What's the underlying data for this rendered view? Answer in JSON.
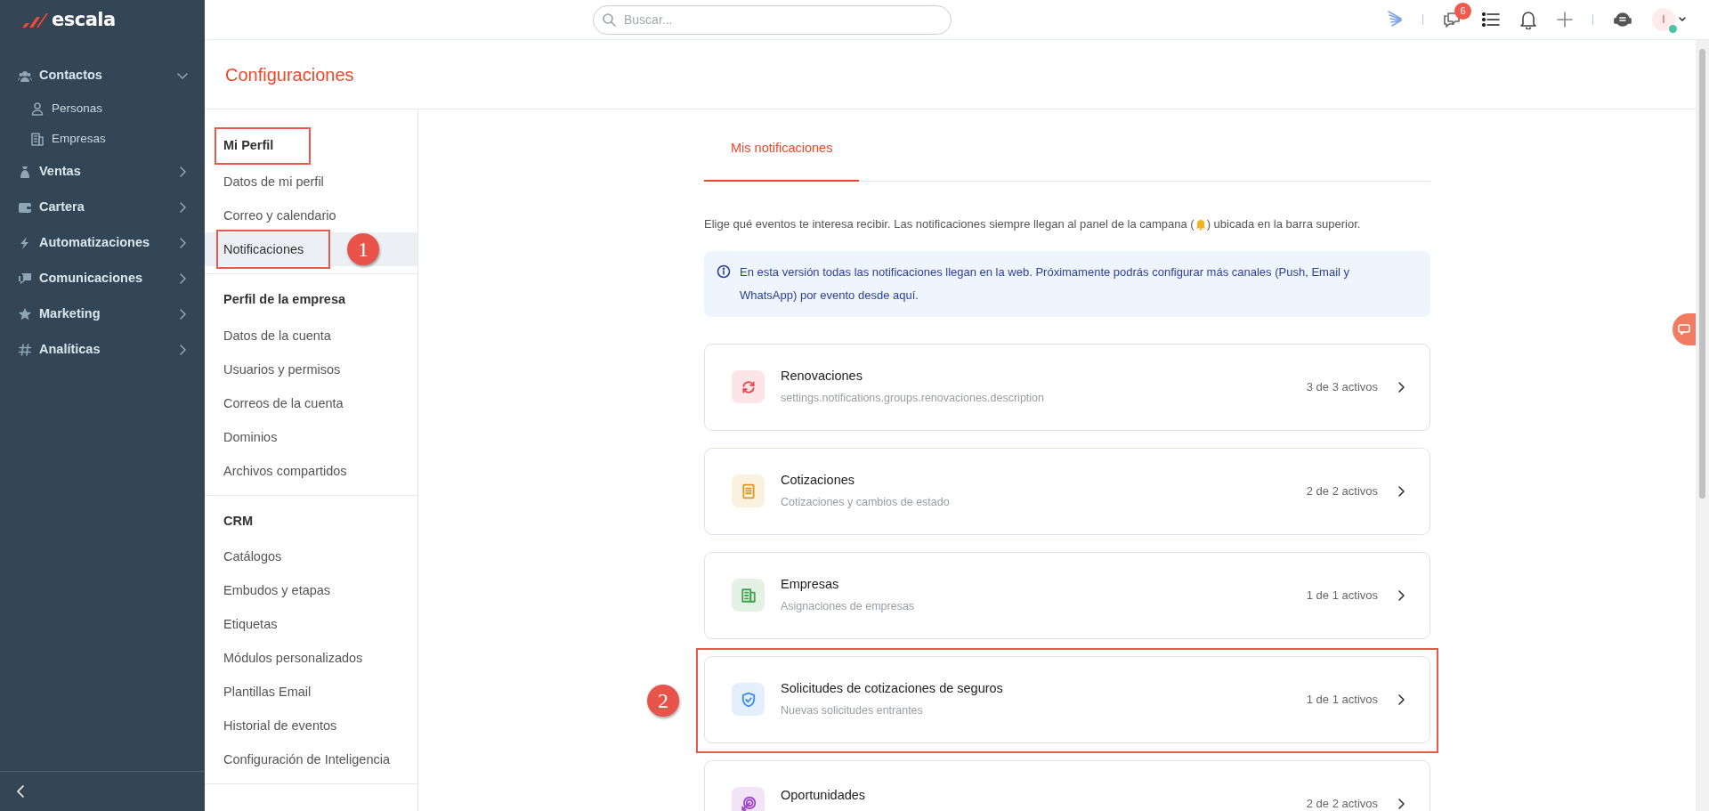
{
  "app": {
    "logo_text": "escala"
  },
  "sidebar": {
    "items": [
      {
        "label": "Contactos",
        "expanded": true,
        "children": [
          {
            "label": "Personas"
          },
          {
            "label": "Empresas"
          }
        ]
      },
      {
        "label": "Ventas",
        "expanded": false
      },
      {
        "label": "Cartera",
        "expanded": false
      },
      {
        "label": "Automatizaciones",
        "expanded": false
      },
      {
        "label": "Comunicaciones",
        "expanded": false
      },
      {
        "label": "Marketing",
        "expanded": false
      },
      {
        "label": "Analíticas",
        "expanded": false
      }
    ]
  },
  "topbar": {
    "search": {
      "placeholder": "Buscar..."
    },
    "messages_badge": "6",
    "avatar_initial": "I"
  },
  "page": {
    "title": "Configuraciones"
  },
  "settings_menu": {
    "groups": [
      {
        "title": "Mi Perfil",
        "highlighted": true,
        "items": [
          {
            "label": "Datos de mi perfil",
            "selected": false,
            "highlighted": false
          },
          {
            "label": "Correo y calendario",
            "selected": false,
            "highlighted": false
          },
          {
            "label": "Notificaciones",
            "selected": true,
            "highlighted": true,
            "callout": "1"
          }
        ]
      },
      {
        "title": "Perfil de la empresa",
        "highlighted": false,
        "items": [
          {
            "label": "Datos de la cuenta",
            "selected": false,
            "highlighted": false
          },
          {
            "label": "Usuarios y permisos",
            "selected": false,
            "highlighted": false
          },
          {
            "label": "Correos de la cuenta",
            "selected": false,
            "highlighted": false
          },
          {
            "label": "Dominios",
            "selected": false,
            "highlighted": false
          },
          {
            "label": "Archivos compartidos",
            "selected": false,
            "highlighted": false
          }
        ]
      },
      {
        "title": "CRM",
        "highlighted": false,
        "items": [
          {
            "label": "Catálogos",
            "selected": false,
            "highlighted": false
          },
          {
            "label": "Embudos y etapas",
            "selected": false,
            "highlighted": false
          },
          {
            "label": "Etiquetas",
            "selected": false,
            "highlighted": false
          },
          {
            "label": "Módulos personalizados",
            "selected": false,
            "highlighted": false
          },
          {
            "label": "Plantillas Email",
            "selected": false,
            "highlighted": false
          },
          {
            "label": "Historial de eventos",
            "selected": false,
            "highlighted": false
          },
          {
            "label": "Configuración de Inteligencia",
            "selected": false,
            "highlighted": false
          }
        ]
      }
    ]
  },
  "notifications": {
    "tabs": [
      {
        "label": "Mis notificaciones",
        "selected": true
      }
    ],
    "description": [
      "Elige qué eventos te interesa recibir. Las notificaciones siempre llegan al panel de la campana (",
      ") ubicada en la barra superior."
    ],
    "info": "En esta versión todas las notificaciones llegan en la web. Próximamente podrás configurar más canales (Push, Email y WhatsApp) por evento desde aquí.",
    "groups": [
      {
        "title": "Renovaciones",
        "description": "settings.notifications.groups.renovaciones.description",
        "count": "3 de 3 activos",
        "color": "#e5484d",
        "highlighted": false
      },
      {
        "title": "Cotizaciones",
        "description": "Cotizaciones y cambios de estado",
        "count": "2 de 2 activos",
        "color": "#d99a1c",
        "highlighted": false
      },
      {
        "title": "Empresas",
        "description": "Asignaciones de empresas",
        "count": "1 de 1 activos",
        "color": "#3fa34d",
        "highlighted": false
      },
      {
        "title": "Solicitudes de cotizaciones de seguros",
        "description": "Nuevas solicitudes entrantes",
        "count": "1 de 1 activos",
        "color": "#3b8ee8",
        "highlighted": true,
        "callout": "2"
      },
      {
        "title": "Oportunidades",
        "count": "2 de 2 activos",
        "color": "#a043c9",
        "highlighted": false
      }
    ]
  }
}
